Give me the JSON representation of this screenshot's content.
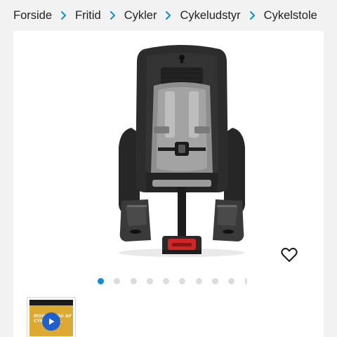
{
  "breadcrumb": {
    "items": [
      "Forside",
      "Fritid",
      "Cykler",
      "Cykeludstyr",
      "Cykelstole"
    ]
  },
  "product": {
    "image_icon": "child-bike-seat-image",
    "wishlist_icon": "heart-outline-icon",
    "gallery": {
      "count": 10,
      "active_index": 0
    }
  },
  "thumbnail": {
    "type": "video",
    "overlay_text": "MONTERING AF CYKELSTOL"
  },
  "colors": {
    "background": "#f2f2f2",
    "card": "#ffffff",
    "active_dot": "#0b8fd6",
    "inactive_dot": "#dcdcdc",
    "thumb_bg": "#dcaa33",
    "play_button": "#1f5fd0"
  }
}
